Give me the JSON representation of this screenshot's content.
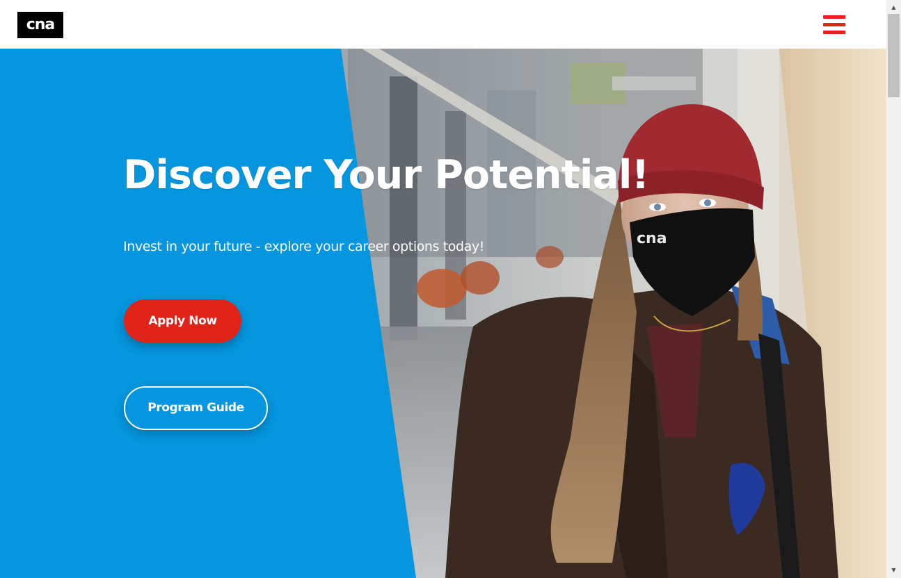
{
  "header": {
    "logo_text": "cna",
    "menu_icon": "hamburger-menu-icon"
  },
  "hero": {
    "title": "Discover Your Potential!",
    "subtitle": "Invest in your future - explore your career options today!",
    "apply_button": "Apply Now",
    "guide_button": "Program Guide",
    "mask_logo_text": "cna"
  },
  "scrollbar": {
    "up_icon": "▲",
    "down_icon": "▼"
  },
  "colors": {
    "brand_blue": "#0596df",
    "brand_red": "#df2318",
    "menu_red": "#e1251b",
    "logo_bg": "#000000"
  }
}
